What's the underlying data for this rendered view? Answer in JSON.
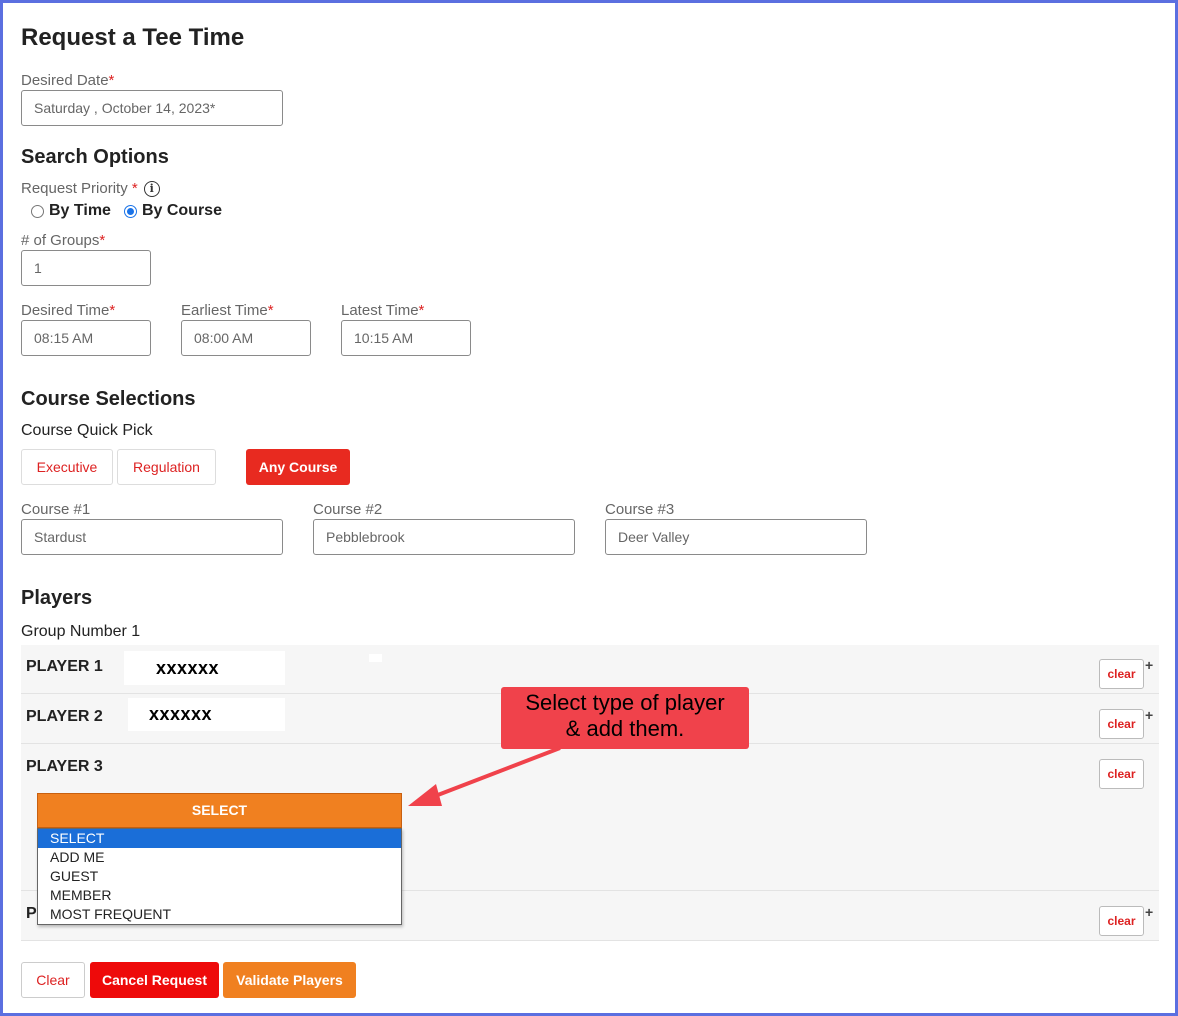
{
  "page": {
    "title": "Request a Tee Time"
  },
  "date": {
    "label": "Desired Date",
    "required_mark": "*",
    "value": "Saturday , October 14, 2023*"
  },
  "search_options": {
    "title": "Search Options",
    "priority_label": "Request Priority",
    "required_mark": "*",
    "radios": [
      {
        "label": "By Time",
        "checked": false
      },
      {
        "label": "By Course",
        "checked": true
      }
    ],
    "groups_label": "# of Groups",
    "groups_value": "1",
    "desired_time_label": "Desired Time",
    "desired_time_value": "08:15 AM",
    "earliest_time_label": "Earliest Time",
    "earliest_time_value": "08:00 AM",
    "latest_time_label": "Latest Time",
    "latest_time_value": "10:15 AM"
  },
  "courses": {
    "title": "Course Selections",
    "quick_pick_label": "Course Quick Pick",
    "quick_picks": [
      "Executive",
      "Regulation",
      "Any Course"
    ],
    "course1_label": "Course #1",
    "course1_value": "Stardust",
    "course2_label": "Course #2",
    "course2_value": "Pebblebrook",
    "course3_label": "Course #3",
    "course3_value": "Deer Valley"
  },
  "players": {
    "title": "Players",
    "group_label": "Group Number 1",
    "rows": [
      {
        "label": "PLAYER 1",
        "name": "xxxxxx"
      },
      {
        "label": "PLAYER 2",
        "name": "xxxxxx"
      },
      {
        "label": "PLAYER 3",
        "name": ""
      },
      {
        "label": "P",
        "name": ""
      }
    ],
    "clear_label": "clear",
    "plus": "+",
    "select_label": "SELECT",
    "dropdown_options": [
      "SELECT",
      "ADD ME",
      "GUEST",
      "MEMBER",
      "MOST FREQUENT"
    ],
    "selected_option": "SELECT"
  },
  "callout": {
    "line1": "Select type of player",
    "line2": "& add them."
  },
  "footer": {
    "clear": "Clear",
    "cancel": "Cancel Request",
    "validate": "Validate Players"
  },
  "colors": {
    "accent_red": "#e82a20",
    "orange": "#f08020",
    "callout": "#f0424b",
    "frame": "#5b6fe0",
    "selected_option": "#1a6ed8"
  },
  "icons": {
    "info": "info-icon",
    "arrow": "arrow-icon"
  }
}
